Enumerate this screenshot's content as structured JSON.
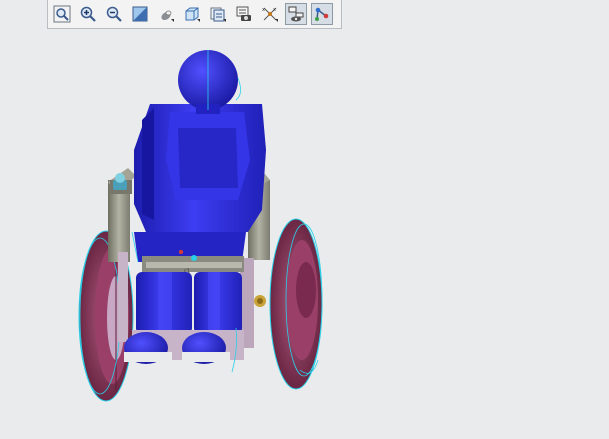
{
  "toolbar": {
    "buttons": [
      {
        "icon": "zoom-fit-icon",
        "active": false
      },
      {
        "icon": "zoom-in-icon",
        "active": false
      },
      {
        "icon": "zoom-out-icon",
        "active": false
      },
      {
        "icon": "repaint-icon",
        "active": false
      },
      {
        "icon": "reorient-icon",
        "active": false
      },
      {
        "icon": "display-style-icon",
        "active": false
      },
      {
        "icon": "saved-views-icon",
        "active": false
      },
      {
        "icon": "view-manager-icon",
        "active": false
      },
      {
        "icon": "datum-display-icon",
        "active": false
      },
      {
        "icon": "annotation-display-icon",
        "active": true
      },
      {
        "icon": "spin-center-icon",
        "active": true
      }
    ]
  },
  "model": {
    "name": "wheelchair-with-occupant-model",
    "colors": {
      "body": "#2f2fe0",
      "body_dark": "#1c1cae",
      "wheel": "#7a2a4e",
      "wheel_light": "#b05a7e",
      "frame": "#9a9a8c",
      "frame_dark": "#6e6e62",
      "edge": "#2ad0e8",
      "background": "#e9ebed"
    }
  }
}
